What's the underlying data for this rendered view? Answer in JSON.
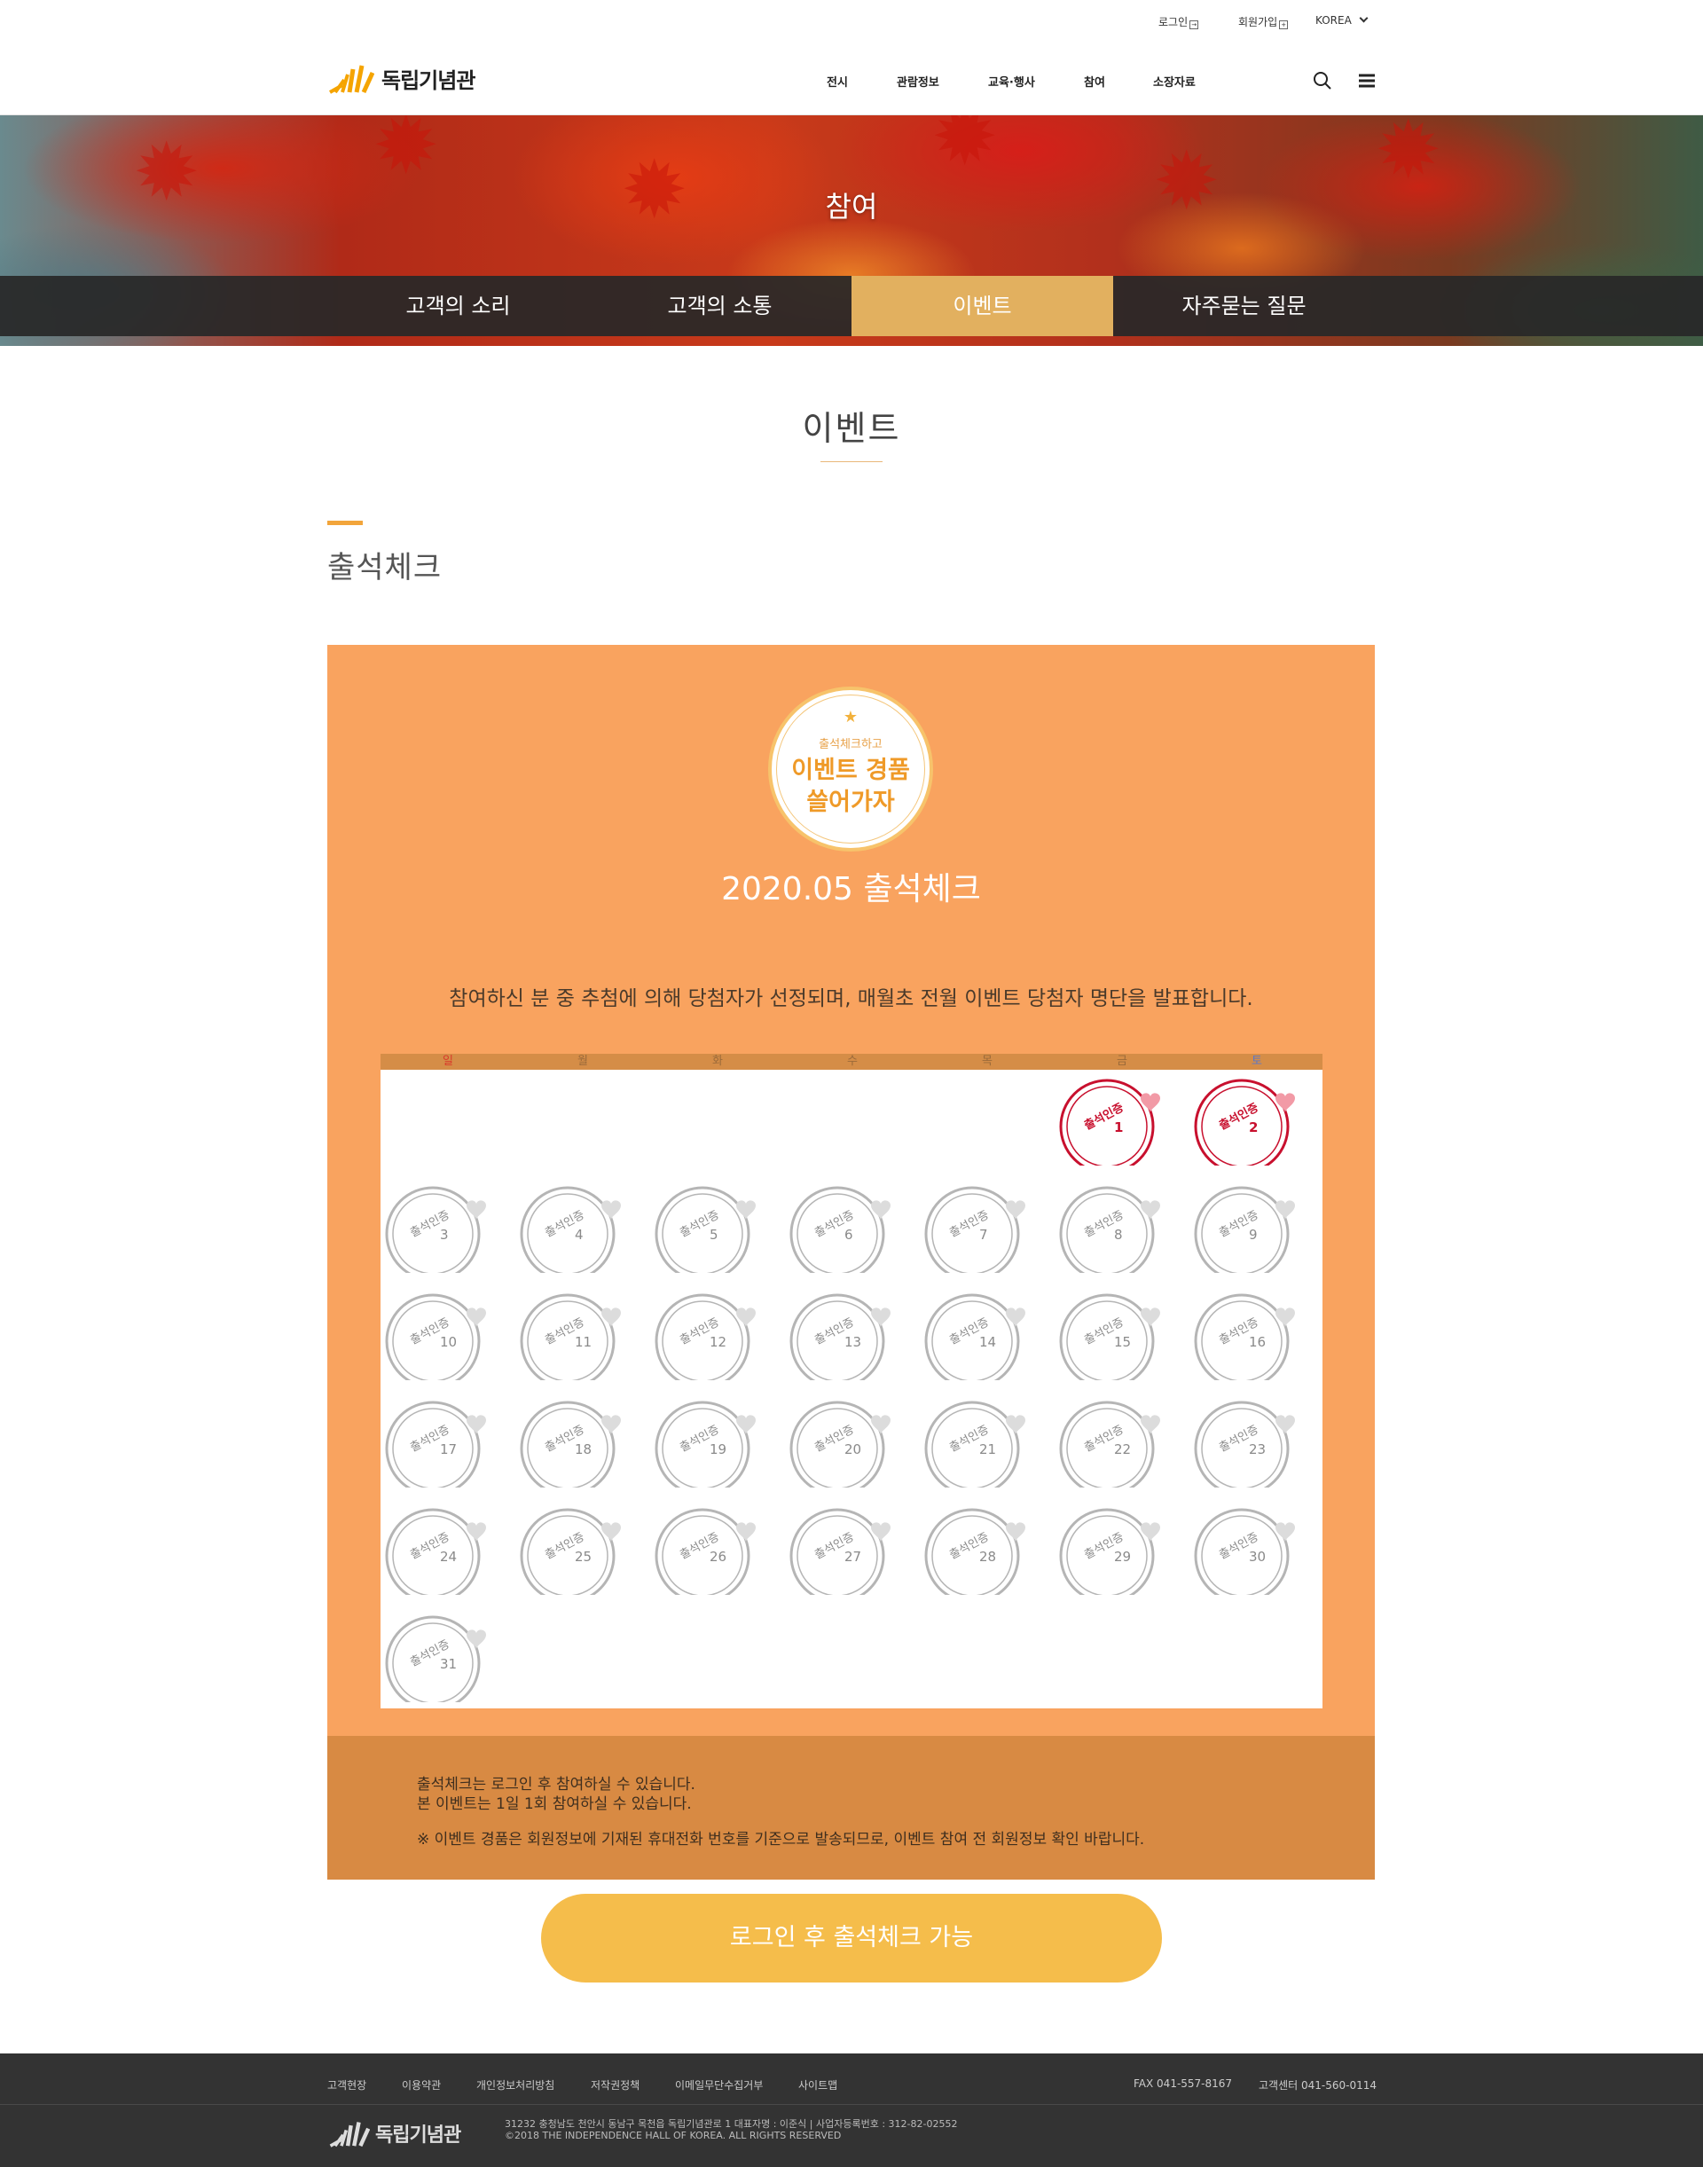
{
  "util": {
    "login": "로그인",
    "join": "회원가입",
    "lang": "KOREA"
  },
  "header": {
    "logo": "독립기념관",
    "nav": [
      "전시",
      "관람정보",
      "교육·행사",
      "참여",
      "소장자료"
    ]
  },
  "hero": {
    "title": "참여",
    "tabs": [
      "고객의 소리",
      "고객의 소통",
      "이벤트",
      "자주묻는 질문"
    ],
    "active_tab": 2
  },
  "page": {
    "title": "이벤트",
    "section": "출석체크"
  },
  "event": {
    "badge_small": "출석체크하고",
    "badge_line1": "이벤트 경품",
    "badge_line2": "쓸어가자",
    "title": "2020.05 출석체크",
    "desc": "참여하신 분 중 추첨에 의해 당첨자가 선정되며, 매월초 전월 이벤트 당첨자 명단을 발표합니다."
  },
  "calendar": {
    "weekdays": [
      "일",
      "월",
      "화",
      "수",
      "목",
      "금",
      "토"
    ],
    "stamp_label": "출석인증",
    "first_weekday_index": 5,
    "days_in_month": 31,
    "checked_days": [
      1,
      2
    ],
    "colors": {
      "checked": "#c8102e",
      "unchecked": "#b5b5b5",
      "heart_checked": "#f29aa6",
      "heart_unchecked": "#dcdcdc"
    }
  },
  "notice": {
    "line1": "출석체크는 로그인 후 참여하실 수 있습니다.",
    "line2": "본 이벤트는 1일 1회 참여하실 수 있습니다.",
    "line3": "※ 이벤트 경품은 회원정보에 기재된 휴대전화 번호를 기준으로 발송되므로, 이벤트 참여 전 회원정보 확인 바랍니다."
  },
  "button": {
    "login_check": "로그인 후 출석체크 가능"
  },
  "footer": {
    "links": [
      "고객현장",
      "이용약관",
      "개인정보처리방침",
      "저작권정책",
      "이메일무단수집거부",
      "사이트맵"
    ],
    "fax": "FAX 041-557-8167",
    "center": "고객센터 041-560-0114",
    "logo": "독립기념관",
    "address": "31232 충청남도 천안시 동남구 목천읍 독립기념관로 1 대표자명 : 이준식 | 사업자등록번호 : 312-82-02552",
    "copyright": "©2018 THE INDEPENDENCE HALL OF KOREA. ALL RIGHTS RESERVED"
  }
}
